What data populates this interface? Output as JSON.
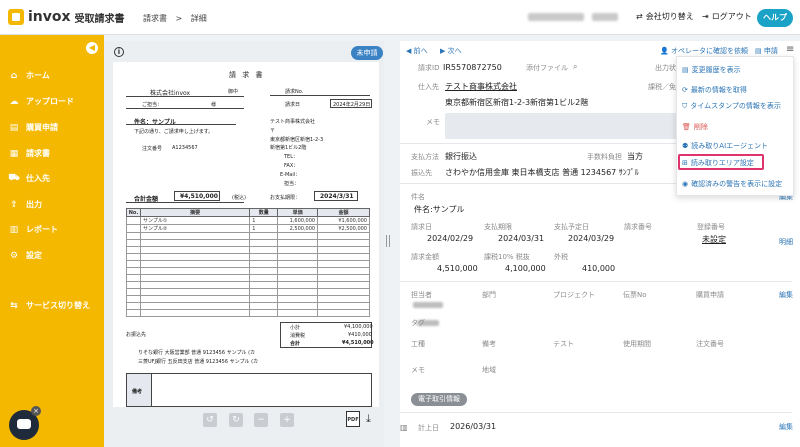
{
  "header": {
    "logo": "invox",
    "logo_sub": "受取請求書",
    "breadcrumb": [
      "請求書",
      ">",
      "詳細"
    ],
    "switch_company": "会社切り替え",
    "logout": "ログアウト",
    "help": "ヘルプ"
  },
  "sidebar": {
    "items": [
      {
        "label": "ホーム",
        "icon": "home-icon"
      },
      {
        "label": "アップロード",
        "icon": "upload-icon"
      },
      {
        "label": "購買申請",
        "icon": "doc-icon"
      },
      {
        "label": "請求書",
        "icon": "invoice-icon"
      },
      {
        "label": "仕入先",
        "icon": "supplier-icon"
      },
      {
        "label": "出力",
        "icon": "output-icon"
      },
      {
        "label": "レポート",
        "icon": "report-icon"
      },
      {
        "label": "設定",
        "icon": "gear-icon"
      },
      {
        "label": "サービス切り替え",
        "icon": "switch-icon"
      }
    ]
  },
  "doc": {
    "status": "未申請",
    "title": "請 求 書",
    "to_company": "株式会社invox",
    "to_suffix": "御中",
    "greeting": "ご担当：",
    "greeting_suffix": "様",
    "invoice_no_label": "請求No.",
    "invoice_date_label": "請求日",
    "invoice_date": "2024年2月29日",
    "subject_label": "件名：サンプル",
    "subject_note": "下記の通り、ご請求申し上げます。",
    "order_no_label": "注文番号",
    "order_no": "A1234567",
    "issuer_name": "テスト商事株式会社",
    "issuer_zip": "〒",
    "issuer_addr1": "東京都新宿区新宿1-2-3",
    "issuer_addr2": "新宿第1ビル2階",
    "issuer_tel": "TEL：",
    "issuer_fax": "FAX：",
    "issuer_email": "E-Mail：",
    "issuer_person": "担当：",
    "total_label": "合計金額",
    "total_value": "¥4,510,000",
    "tax_incl": "(税込)",
    "due_label": "お支払期限：",
    "due_value": "2024/3/31",
    "table_headers": [
      "No.",
      "摘要",
      "数量",
      "単価",
      "金額"
    ],
    "rows": [
      [
        "",
        "サンプル①",
        "1",
        "1,600,000",
        "¥1,600,000"
      ],
      [
        "",
        "サンプル②",
        "1",
        "2,500,000",
        "¥2,500,000"
      ]
    ],
    "subtotal_label": "小計",
    "subtotal_value": "¥4,100,000",
    "tax_label": "消費税",
    "tax_value": "¥410,000",
    "grand_label": "合計",
    "grand_value": "¥4,510,000",
    "bank_label": "お振込先",
    "bank1": "りそな銀行 大阪営業部 普通 9123456 サンプル (カ",
    "bank2": "三菱UFJ銀行 五反田支店 普通 9123456 サンプル (カ",
    "remarks_label": "備考"
  },
  "right": {
    "prev": "前へ",
    "next": "次へ",
    "ask_operator": "オペレータに確認を依頼",
    "apply": "申請",
    "request_id_label": "請求ID",
    "request_id": "IR5570872750",
    "attach_label": "添付ファイル",
    "output_label": "出力状",
    "supplier_label": "仕入先",
    "supplier": "テスト商事株式会社",
    "supplier_addr": "東京都新宿区新宿1-2-3新宿第1ビル2階",
    "tax_class_label": "課税／免",
    "memo_label": "メモ",
    "pay_method_label": "支払方法",
    "pay_method": "銀行振込",
    "fee_label": "手数料負担",
    "fee": "当方",
    "dest_label": "振込先",
    "dest": "さわやか信用金庫 東日本橋支店 普通 1234567 ｻﾝﾌﾟﾙ",
    "subject_label": "件名",
    "subject": "件名:サンプル",
    "edit": "編集",
    "date_label": "請求日",
    "date": "2024/02/29",
    "due_label": "支払期限",
    "due": "2024/03/31",
    "planned_label": "支払予定日",
    "planned": "2024/03/29",
    "invno_label": "請求番号",
    "reg_label": "登録番号",
    "reg": "未設定",
    "detail": "明細",
    "amount_label": "請求金額",
    "amount": "4,510,000",
    "tax10_label": "課税10% 税抜",
    "tax10": "4,100,000",
    "outside_label": "外税",
    "outside": "410,000",
    "person_label": "担当者",
    "dept_label": "部門",
    "project_label": "プロジェクト",
    "slip_label": "伝票No",
    "purchase_label": "購買申請",
    "tag_label": "タグ",
    "process_label": "工種",
    "remarks_label": "備考",
    "test_label": "テスト",
    "usage_label": "使用期間",
    "order_label": "注文番号",
    "memo2_label": "メモ",
    "region_label": "地域",
    "etrans": "電子取引情報",
    "booking_label": "計上日",
    "booking": "2026/03/31"
  },
  "menu": [
    {
      "label": "変更履歴を表示",
      "danger": false
    },
    {
      "label": "最新の情報を取得",
      "danger": false
    },
    {
      "label": "タイムスタンプの情報を表示",
      "danger": false
    },
    {
      "label": "削除",
      "danger": true
    },
    {
      "label": "読み取りAIエージェント",
      "danger": false
    },
    {
      "label": "読み取りエリア設定",
      "danger": false
    },
    {
      "label": "確認済みの警告を表示に設定",
      "danger": false
    }
  ]
}
